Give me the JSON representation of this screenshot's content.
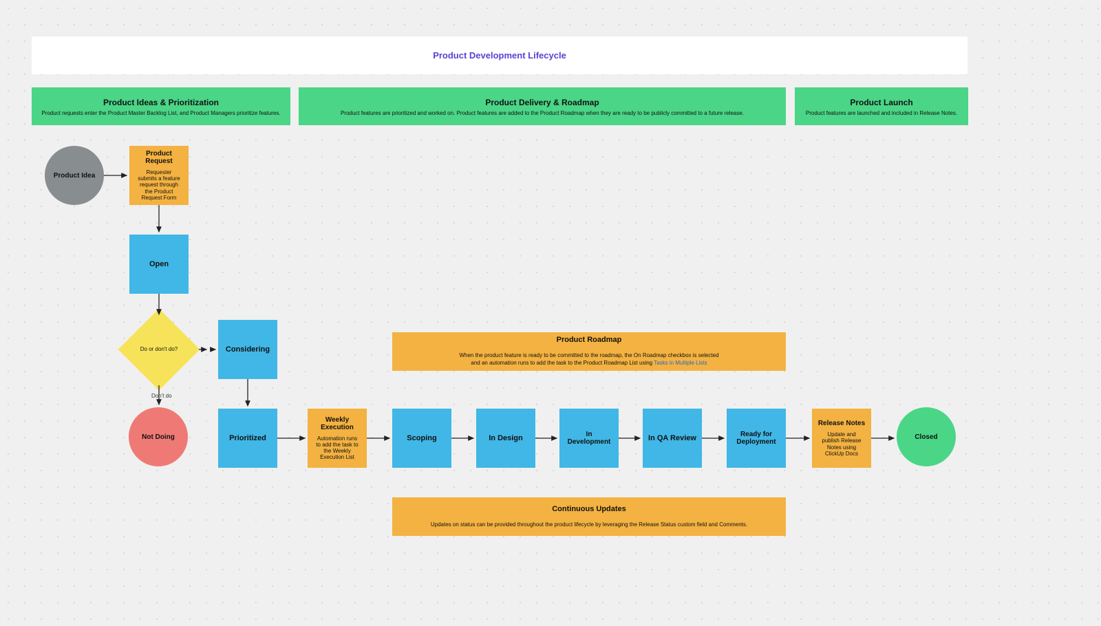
{
  "title": "Product Development Lifecycle",
  "phases": {
    "ideas": {
      "title": "Product Ideas & Prioritization",
      "sub": "Product requests enter the Product Master Backlog List, and Product Managers prioritize features."
    },
    "delivery": {
      "title": "Product Delivery & Roadmap",
      "sub": "Product features are prioritized and worked on. Product features are added to the Product Roadmap when they are ready to be publicly committed to a future release."
    },
    "launch": {
      "title": "Product Launch",
      "sub": "Product features are launched and included in Release Notes."
    }
  },
  "nodes": {
    "product_idea": {
      "title": "Product Idea"
    },
    "product_request": {
      "title": "Product Request",
      "sub": "Requester submits a feature request through the Product Request Form"
    },
    "open": {
      "title": "Open"
    },
    "decision": {
      "title": "Do or don't do?"
    },
    "considering": {
      "title": "Considering"
    },
    "not_doing": {
      "title": "Not Doing"
    },
    "prioritized": {
      "title": "Prioritized"
    },
    "weekly": {
      "title": "Weekly Execution",
      "sub": "Automation runs to add the task to the Weekly Execution List"
    },
    "scoping": {
      "title": "Scoping"
    },
    "in_design": {
      "title": "In Design"
    },
    "in_dev": {
      "title": "In Development"
    },
    "in_qa": {
      "title": "In QA Review"
    },
    "ready": {
      "title": "Ready for Deployment"
    },
    "release_notes": {
      "title": "Release Notes",
      "sub": "Update and publish Release Notes using ClickUp Docs"
    },
    "closed": {
      "title": "Closed"
    }
  },
  "panels": {
    "roadmap": {
      "title": "Product Roadmap",
      "sub_a": "When the product feature is ready to be committed to the roadmap, the On Roadmap checkbox is selected",
      "sub_b": "and an automation runs to add the task to the Product Roadmap List using ",
      "link": "Tasks in Multiple Lists"
    },
    "continuous": {
      "title": "Continuous Updates",
      "sub": "Updates on status can be provided throughout the product lifecycle by leveraging the Release Status custom field and Comments."
    }
  },
  "edge_labels": {
    "dont_do": "Don't do"
  }
}
